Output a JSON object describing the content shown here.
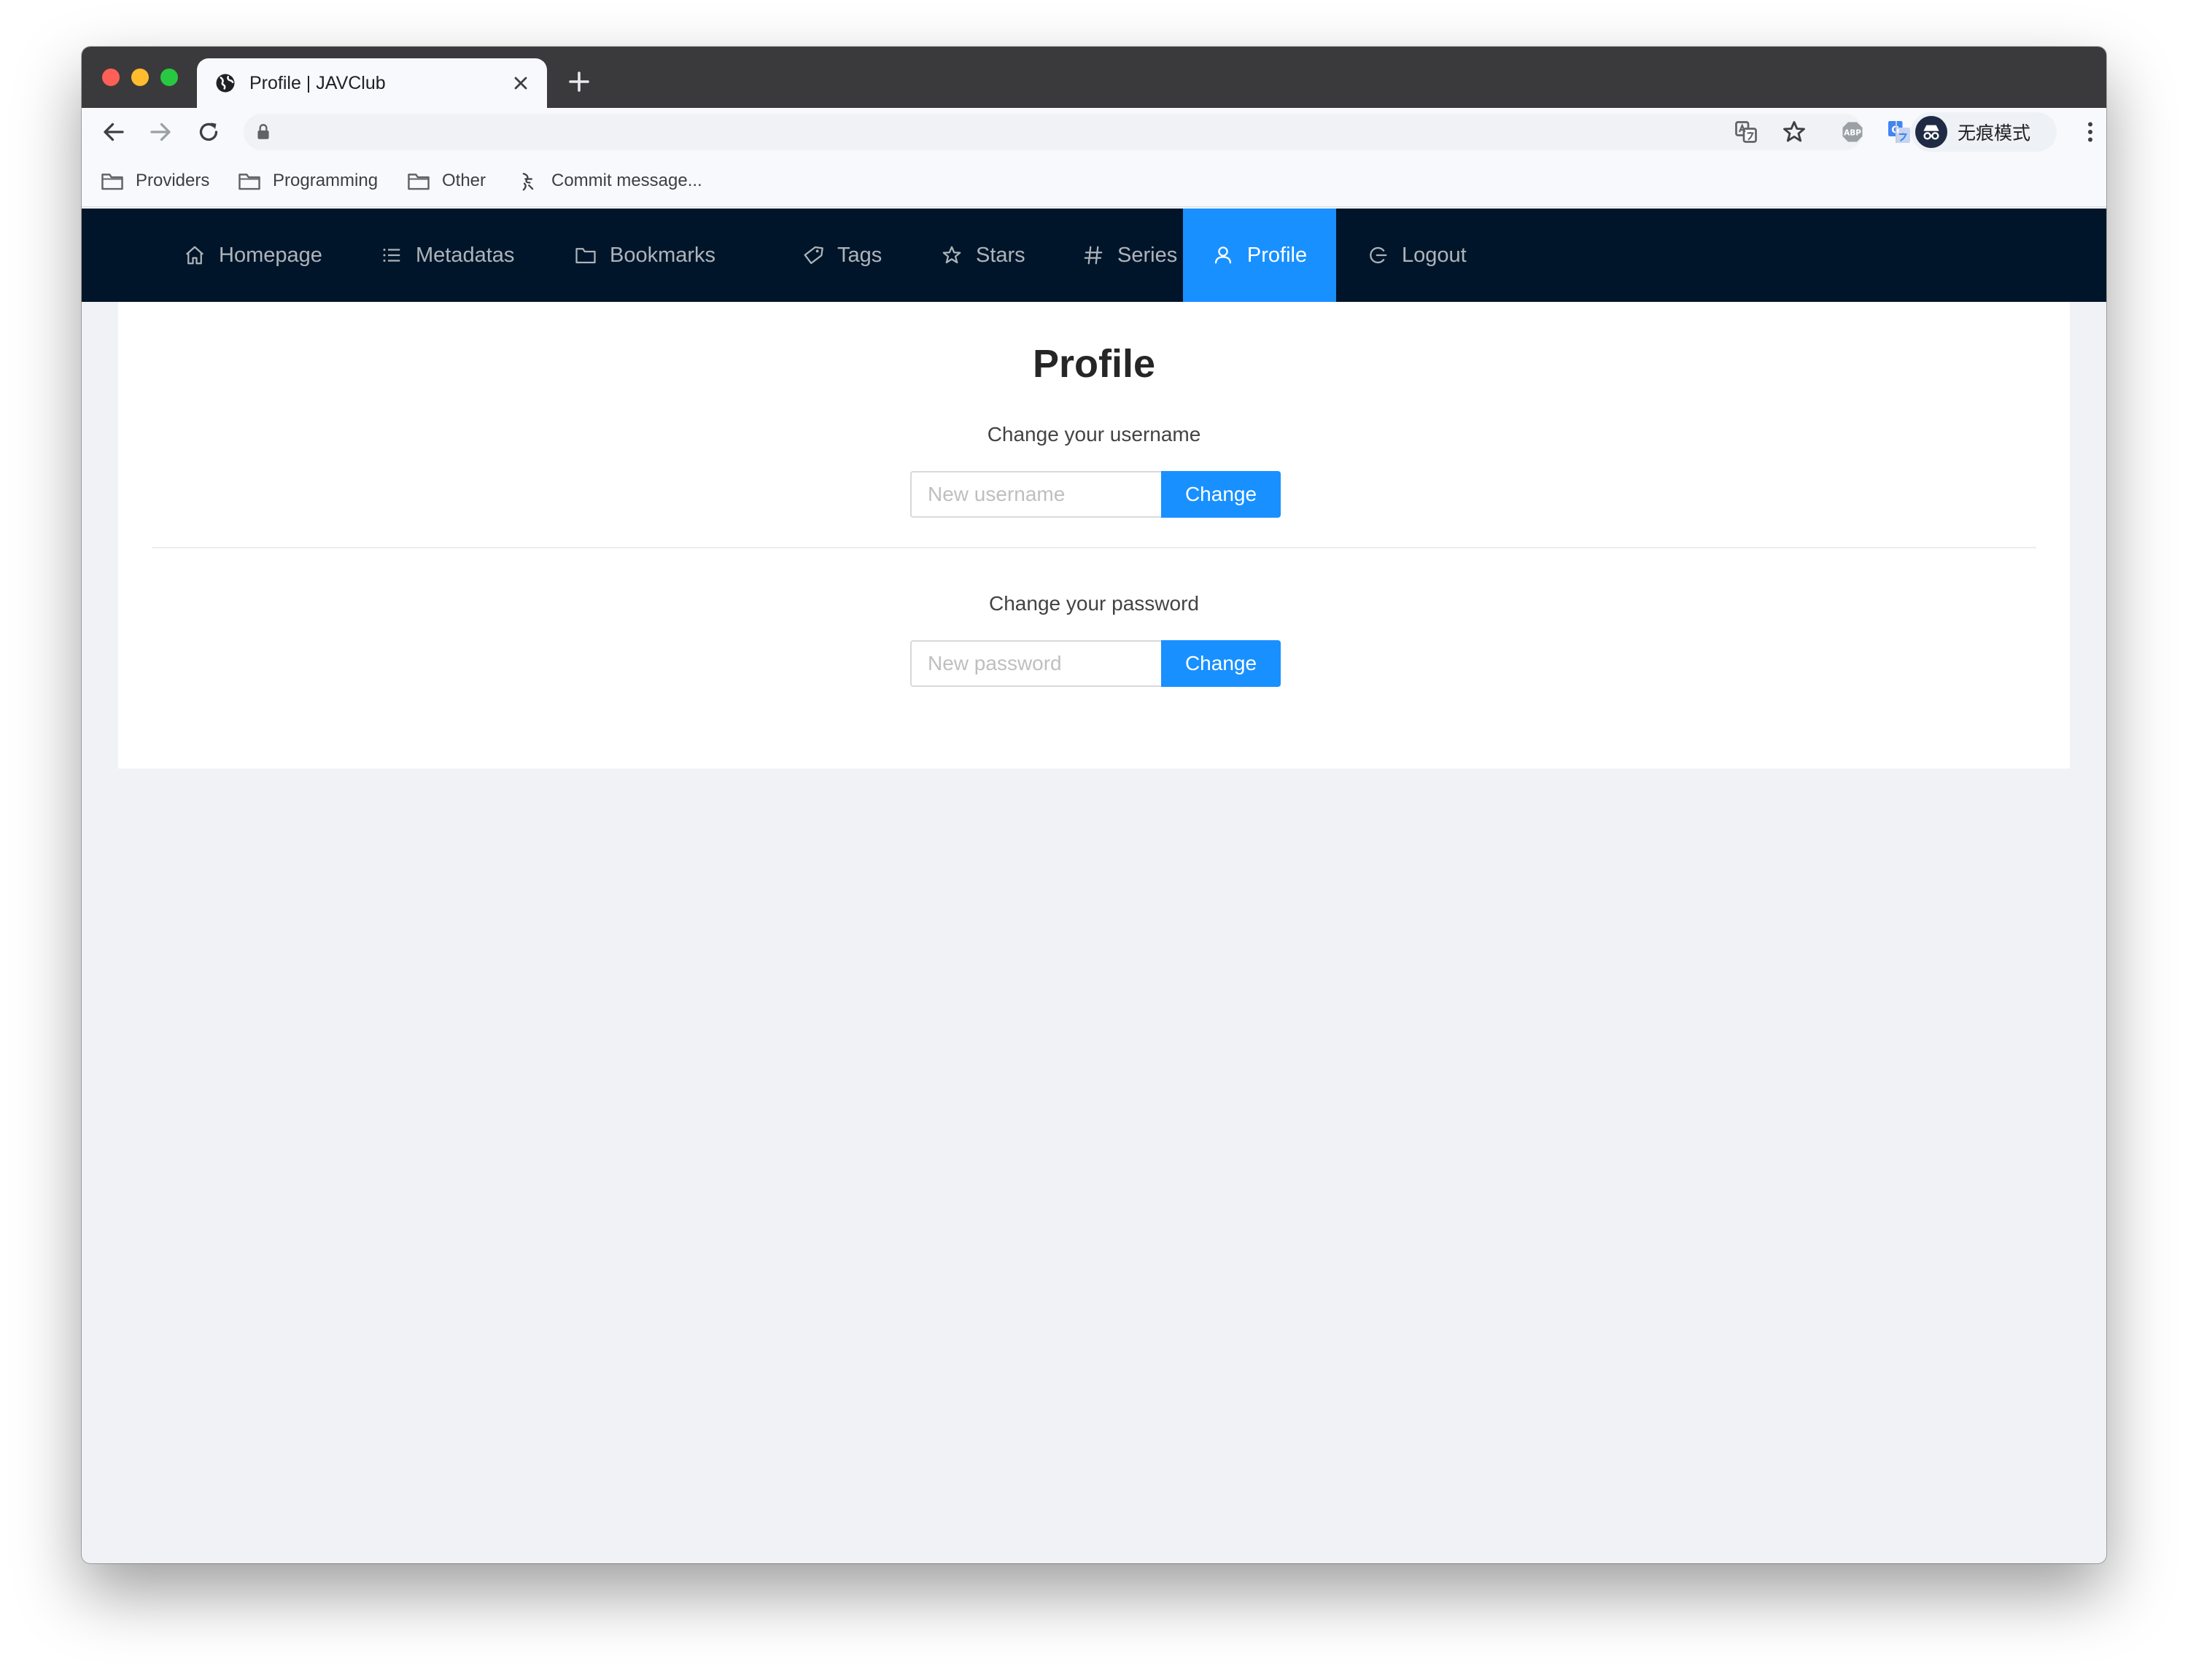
{
  "browser": {
    "tab_title": "Profile | JAVClub",
    "incognito_label": "无痕模式",
    "bookmarks": [
      {
        "label": "Providers",
        "icon": "folder-icon"
      },
      {
        "label": "Programming",
        "icon": "folder-icon"
      },
      {
        "label": "Other",
        "icon": "folder-icon"
      },
      {
        "label": "Commit message...",
        "icon": "commit-icon"
      }
    ]
  },
  "nav": {
    "items": [
      {
        "label": "Homepage",
        "icon": "home-icon"
      },
      {
        "label": "Metadatas",
        "icon": "list-icon"
      },
      {
        "label": "Bookmarks",
        "icon": "folder-icon"
      },
      {
        "label": "Tags",
        "icon": "tag-icon"
      },
      {
        "label": "Stars",
        "icon": "star-icon"
      },
      {
        "label": "Series",
        "icon": "hash-icon"
      },
      {
        "label": "Profile",
        "icon": "user-icon",
        "active": true
      },
      {
        "label": "Logout",
        "icon": "logout-icon"
      }
    ],
    "active_color": "#1890ff",
    "background_color": "#001529"
  },
  "profile": {
    "title": "Profile",
    "username": {
      "label": "Change your username",
      "placeholder": "New username",
      "value": "",
      "button": "Change"
    },
    "password": {
      "label": "Change your password",
      "placeholder": "New password",
      "value": "",
      "button": "Change"
    }
  }
}
